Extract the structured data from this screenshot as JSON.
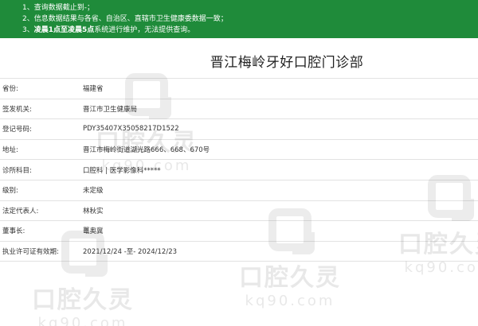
{
  "notice": {
    "line1": "1、查询数据截止到-；",
    "line2": "2、信息数据结果与各省、自治区、直辖市卫生健康委数据一致；",
    "line3_prefix": "3、",
    "line3_bold1": "凌晨1点至凌晨5点",
    "line3_rest": "系统进行维护，无法提供查询。"
  },
  "page_title": "晋江梅岭牙好口腔门诊部",
  "rows": [
    {
      "label": "省份:",
      "value": "福建省"
    },
    {
      "label": "签发机关:",
      "value": "晋江市卫生健康局"
    },
    {
      "label": "登记号码:",
      "value": "PDY35407X35058217D1522"
    },
    {
      "label": "地址:",
      "value": "晋江市梅岭街道湖光路666、668、670号"
    },
    {
      "label": "诊所科目:",
      "value": "口腔科 | 医学影像科*****"
    },
    {
      "label": "级别:",
      "value": "未定级"
    },
    {
      "label": "法定代表人:",
      "value": "林秋实"
    },
    {
      "label": "董事长:",
      "value": "鼍奥冀"
    },
    {
      "label": "执业许可证有效期:",
      "value": "2021/12/24 -至- 2024/12/23"
    }
  ],
  "watermark": {
    "name": "口腔久灵",
    "url": "kq90.com"
  },
  "colors": {
    "notice_bg": "#1f8b3a",
    "row_border": "#e2e2e2"
  }
}
